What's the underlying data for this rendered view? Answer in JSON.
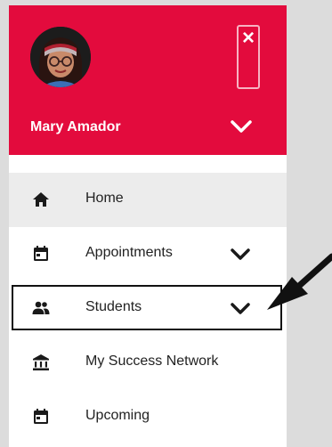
{
  "user": {
    "name": "Mary Amador"
  },
  "header": {
    "close_glyph": "×"
  },
  "colors": {
    "header_bg": "#e30b3d",
    "active_item_bg": "#ececec"
  },
  "nav": {
    "items": [
      {
        "label": "Home",
        "icon": "home-icon",
        "active": true,
        "has_chevron": false
      },
      {
        "label": "Appointments",
        "icon": "calendar-icon",
        "active": false,
        "has_chevron": true
      },
      {
        "label": "Students",
        "icon": "people-icon",
        "active": false,
        "has_chevron": true
      },
      {
        "label": "My Success Network",
        "icon": "bank-icon",
        "active": false,
        "has_chevron": false
      },
      {
        "label": "Upcoming",
        "icon": "calendar-icon",
        "active": false,
        "has_chevron": false
      }
    ]
  }
}
